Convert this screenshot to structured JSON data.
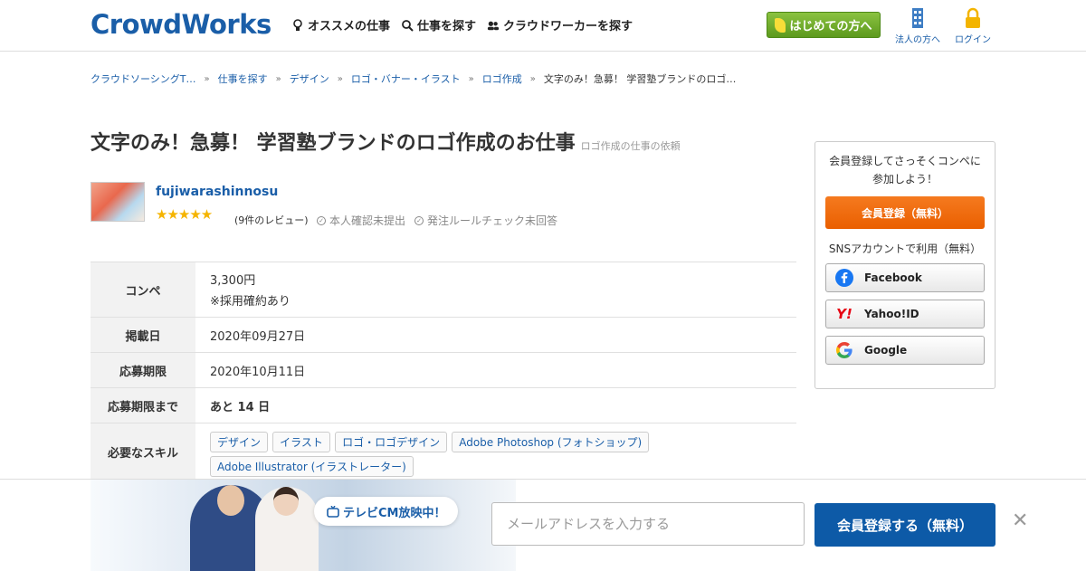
{
  "header": {
    "logo": "CrowdWorks",
    "nav": [
      "オススメの仕事",
      "仕事を探す",
      "クラウドワーカーを探す"
    ],
    "start_button": "はじめての方へ",
    "corporate": "法人の方へ",
    "login": "ログイン"
  },
  "breadcrumb": [
    "クラウドソーシングT…",
    "仕事を探す",
    "デザイン",
    "ロゴ・バナー・イラスト",
    "ロゴ作成",
    "文字のみ！急募！ 学習塾ブランドのロゴ…"
  ],
  "job": {
    "title": "文字のみ！急募！ 学習塾ブランドのロゴ作成のお仕事",
    "subtitle": "ロゴ作成の仕事の依頼"
  },
  "client": {
    "name": "fujiwarashinnosu",
    "stars": "★★★★★",
    "reviews": "(9件のレビュー)",
    "identity": "本人確認未提出",
    "rule_check": "発注ルールチェック未回答"
  },
  "details": {
    "rows": [
      {
        "label": "コンペ",
        "value": "3,300円",
        "value2": "※採用確約あり"
      },
      {
        "label": "掲載日",
        "value": "2020年09月27日"
      },
      {
        "label": "応募期限",
        "value": "2020年10月11日"
      },
      {
        "label": "応募期限まで",
        "value": "あと 14 日"
      },
      {
        "label": "必要なスキル"
      }
    ],
    "skills": [
      "デザイン",
      "イラスト",
      "ロゴ・ロゴデザイン",
      "Adobe Photoshop (フォトショップ)",
      "Adobe Illustrator (イラストレーター)"
    ]
  },
  "sidebar": {
    "message": "会員登録してさっそくコンペに参加しよう！",
    "register": "会員登録（無料）",
    "sns_label": "SNSアカウントで利用（無料）",
    "facebook": "Facebook",
    "yahoo": "Yahoo!ID",
    "google": "Google"
  },
  "bottom": {
    "tvcm": "テレビCM放映中！",
    "email_placeholder": "メールアドレスを入力する",
    "register": "会員登録する（無料）",
    "close": "✕"
  },
  "colors": {
    "brand": "#1a5ea8",
    "orange": "#ea5f00",
    "green": "#5d9a1e"
  }
}
